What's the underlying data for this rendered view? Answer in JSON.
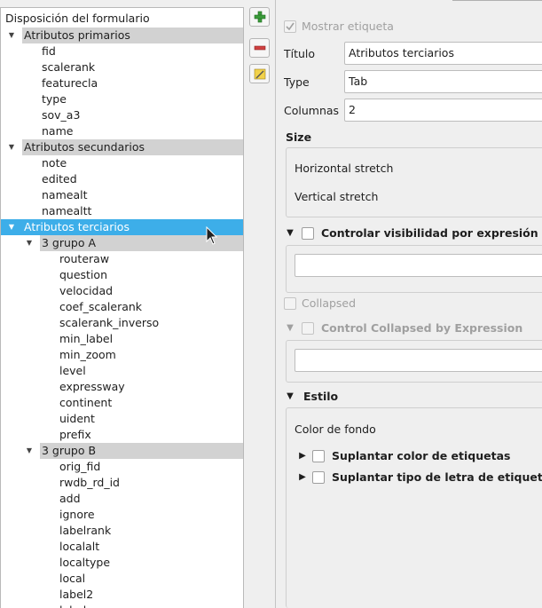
{
  "tree": {
    "header": "Disposición del formulario",
    "rows": [
      {
        "label": "Atributos primarios",
        "kind": "container",
        "level": 0,
        "arrow": "▼"
      },
      {
        "label": "fid",
        "kind": "field",
        "level": 1
      },
      {
        "label": "scalerank",
        "kind": "field",
        "level": 1
      },
      {
        "label": "featurecla",
        "kind": "field",
        "level": 1
      },
      {
        "label": "type",
        "kind": "field",
        "level": 1
      },
      {
        "label": "sov_a3",
        "kind": "field",
        "level": 1
      },
      {
        "label": "name",
        "kind": "field",
        "level": 1
      },
      {
        "label": "Atributos secundarios",
        "kind": "container",
        "level": 0,
        "arrow": "▼"
      },
      {
        "label": "note",
        "kind": "field",
        "level": 1
      },
      {
        "label": "edited",
        "kind": "field",
        "level": 1
      },
      {
        "label": "namealt",
        "kind": "field",
        "level": 1
      },
      {
        "label": "namealtt",
        "kind": "field",
        "level": 1
      },
      {
        "label": "Atributos terciarios",
        "kind": "selected",
        "level": 0,
        "arrow": "▼"
      },
      {
        "label": "3 grupo A",
        "kind": "container",
        "level": 1,
        "arrow": "▼"
      },
      {
        "label": "routeraw",
        "kind": "field",
        "level": 2
      },
      {
        "label": "question",
        "kind": "field",
        "level": 2
      },
      {
        "label": "velocidad",
        "kind": "field",
        "level": 2
      },
      {
        "label": "coef_scalerank",
        "kind": "field",
        "level": 2
      },
      {
        "label": "scalerank_inverso",
        "kind": "field",
        "level": 2
      },
      {
        "label": "min_label",
        "kind": "field",
        "level": 2
      },
      {
        "label": "min_zoom",
        "kind": "field",
        "level": 2
      },
      {
        "label": "level",
        "kind": "field",
        "level": 2
      },
      {
        "label": "expressway",
        "kind": "field",
        "level": 2
      },
      {
        "label": "continent",
        "kind": "field",
        "level": 2
      },
      {
        "label": "uident",
        "kind": "field",
        "level": 2
      },
      {
        "label": "prefix",
        "kind": "field",
        "level": 2
      },
      {
        "label": "3 grupo B",
        "kind": "container",
        "level": 1,
        "arrow": "▼"
      },
      {
        "label": "orig_fid",
        "kind": "field",
        "level": 2
      },
      {
        "label": "rwdb_rd_id",
        "kind": "field",
        "level": 2
      },
      {
        "label": "add",
        "kind": "field",
        "level": 2
      },
      {
        "label": "ignore",
        "kind": "field",
        "level": 2
      },
      {
        "label": "labelrank",
        "kind": "field",
        "level": 2
      },
      {
        "label": "localalt",
        "kind": "field",
        "level": 2
      },
      {
        "label": "localtype",
        "kind": "field",
        "level": 2
      },
      {
        "label": "local",
        "kind": "field",
        "level": 2
      },
      {
        "label": "label2",
        "kind": "field",
        "level": 2
      },
      {
        "label": "label",
        "kind": "field",
        "level": 2
      }
    ]
  },
  "toolbar": {
    "add_icon": "plus-icon",
    "remove_icon": "minus-icon",
    "edit_icon": "pencil-icon"
  },
  "props": {
    "show_label": "Mostrar etiqueta",
    "title_label": "Título",
    "title_value": "Atributos terciarios",
    "type_label": "Type",
    "type_value": "Tab",
    "columns_label": "Columnas",
    "columns_value": "2",
    "size_label": "Size",
    "h_stretch": "Horizontal stretch",
    "v_stretch": "Vertical stretch",
    "visibility_label": "Controlar visibilidad por expresión",
    "collapsed_label": "Collapsed",
    "collapsed_expr_label": "Control Collapsed by Expression",
    "style_label": "Estilo",
    "bg_color_label": "Color de fondo",
    "override_label_color": "Suplantar color de etiquetas",
    "override_label_font": "Suplantar tipo de letra de etiquetas"
  },
  "colors": {
    "selection": "#3daee9",
    "container_bg": "#d2d2d2",
    "add_green": "#3a9b3a",
    "remove_red": "#d04040"
  }
}
